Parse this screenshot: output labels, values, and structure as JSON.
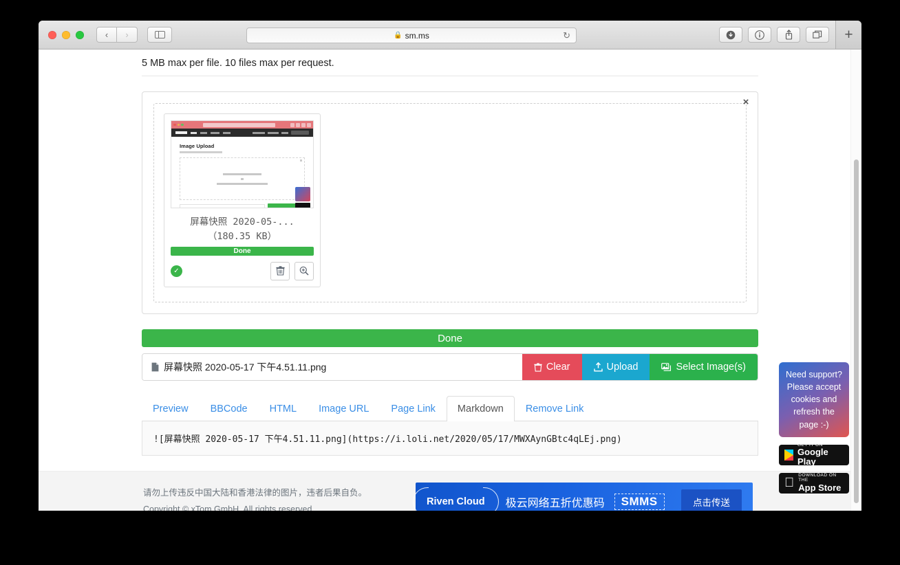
{
  "browser": {
    "url": "sm.ms",
    "lock_icon": "lock-icon",
    "reload_icon": "reload-icon",
    "back_icon": "chevron-left-icon",
    "forward_icon": "chevron-right-icon",
    "sidebar_icon": "sidebar-icon",
    "downloads_icon": "download-icon",
    "info_icon": "info-icon",
    "share_icon": "share-icon",
    "tabs_icon": "tab-overview-icon",
    "new_tab_label": "+"
  },
  "page": {
    "max_note": "5 MB max per file. 10 files max per request.",
    "close_label": "×",
    "thumbnail": {
      "filename_truncated": "屏幕快照 2020-05-...",
      "filesize": "（180.35 KB）",
      "progress_label": "Done",
      "progress_percent": 100,
      "status_icon": "check-circle-icon",
      "delete_icon": "trash-icon",
      "zoom_icon": "magnify-plus-icon",
      "mini": {
        "heading": "Image Upload",
        "drop_text": "Drag & drop files here ...",
        "paste_text": "Copy & paste screenshot here ..."
      }
    },
    "status_bar": "Done",
    "file_input": {
      "file_icon": "file-icon",
      "value": "屏幕快照 2020-05-17 下午4.51.11.png",
      "clear_label": "Clear",
      "clear_icon": "trash-icon",
      "clear_color": "#e54b5a",
      "upload_label": "Upload",
      "upload_icon": "upload-icon",
      "upload_color": "#1ba7cf",
      "select_label": "Select Image(s)",
      "select_icon": "images-icon",
      "select_color": "#2bb14c"
    },
    "tabs": [
      {
        "label": "Preview",
        "active": false
      },
      {
        "label": "BBCode",
        "active": false
      },
      {
        "label": "HTML",
        "active": false
      },
      {
        "label": "Image URL",
        "active": false
      },
      {
        "label": "Page Link",
        "active": false
      },
      {
        "label": "Markdown",
        "active": true
      },
      {
        "label": "Remove Link",
        "active": false
      }
    ],
    "code_content": "![屏幕快照 2020-05-17 下午4.51.11.png](https://i.loli.net/2020/05/17/MWXAynGBtc4qLEj.png)",
    "footer": {
      "line1": "请勿上传违反中国大陆和香港法律的图片，违者后果自负。",
      "line2": "Copyright © xTom GmbH. All rights reserved."
    },
    "ad": {
      "logo": "Riven Cloud",
      "text": "极云网络五折优惠码",
      "chip": "SMMS",
      "cta": "点击传送"
    },
    "rail": {
      "support_text": "Need support? Please accept cookies and refresh the page :-)",
      "google_play_small": "GET IT ON",
      "google_play_big": "Google Play",
      "app_store_small": "Download on the",
      "app_store_big": "App Store",
      "play_icon": "google-play-icon",
      "apple_icon": "apple-icon"
    }
  }
}
